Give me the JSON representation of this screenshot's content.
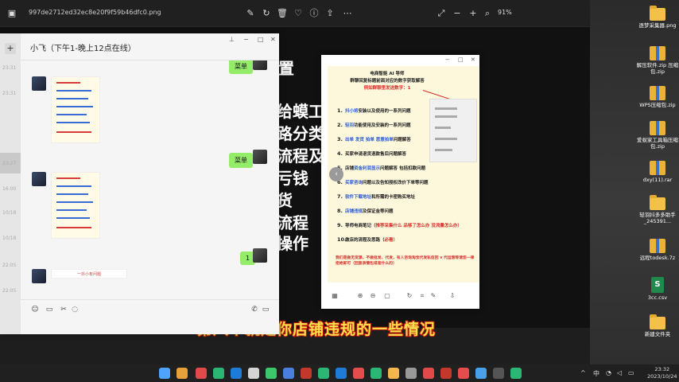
{
  "viewer": {
    "filename": "997de2712ed32ec8e20f9f59b46dfc0.png",
    "zoom": "91%",
    "big_text": [
      "置",
      "给蟆工",
      "路分类",
      "流程及话",
      "亏钱",
      "货",
      "流程",
      "操作"
    ],
    "subtitle": "第八个就是你店铺违规的一些情况"
  },
  "chat": {
    "title": "小飞（下午1-晚上12点在线）",
    "side_times": [
      "23:31",
      "23:31",
      "23:27",
      "16:00",
      "10/18",
      "10/18",
      "22:05",
      "22:05"
    ],
    "messages": {
      "m1": "菜单",
      "m2": "菜单",
      "m3": "1",
      "link": "一抖小有问题"
    }
  },
  "popup": {
    "h1": "电商智能 AI 导师",
    "h2": "群聊回复标题前面对应的数字获取解答",
    "h3": "例如群聊里发送数字：1",
    "items": [
      {
        "n": "1.",
        "a": "抖小将",
        "b": "安装以及使用的一系列问题"
      },
      {
        "n": "2.",
        "a": "轻羽",
        "b": "功能使用及安装的一系列问题"
      },
      {
        "n": "3.",
        "a": "出单 发货 拍单 恶意拍单",
        "b": "问题解答"
      },
      {
        "n": "4.",
        "a": "",
        "b": "买家申请退货退款售后问题解答",
        "mid": "退货退款售后"
      },
      {
        "n": "5.",
        "a": "店铺",
        "b": "问题解答 包括扣款问题",
        "mid": "资金利润显示"
      },
      {
        "n": "6.",
        "a": "买家咨询",
        "b": "问题以及告知授权改价下单等问题"
      },
      {
        "n": "7.",
        "a": "软件下载地址",
        "b": "和所需的卡密购买地址"
      },
      {
        "n": "8.",
        "a": "店铺违规",
        "b": "及保证金等问题"
      },
      {
        "n": "9.",
        "a": "导师电商笔记（",
        "b": "推荐采集什么 品够了怎么办 没流量怎么办）"
      },
      {
        "n": "10.",
        "a": "做店的流程及思路（",
        "b": "必看）"
      }
    ],
    "note": "我们是做无货源，不做批发、代发，有人咨询淘宝代发私信回 v 代运营等请您一律拒绝即可（回复表情包或者什么的）"
  },
  "desktop_icons": [
    {
      "label": "逐梦采集器.png",
      "kind": "folder"
    },
    {
      "label": "解压软件.zip 压缩包.zip",
      "kind": "zip"
    },
    {
      "label": "WPS压缩包.zip",
      "kind": "zip"
    },
    {
      "label": "爱蚁家工具箱压缩包.zip",
      "kind": "zip"
    },
    {
      "label": "dxy(11).rar",
      "kind": "zip"
    },
    {
      "label": "轻羽抖多多助手_245391...",
      "kind": "folder"
    },
    {
      "label": "远程todesk.7z",
      "kind": "zip"
    },
    {
      "label": "3cc.csv",
      "kind": "csv"
    },
    {
      "label": "新建文件夹",
      "kind": "folder"
    }
  ],
  "taskbar": {
    "time": "23:32",
    "date": "2023/10/24",
    "lang": "中",
    "colors": [
      "#4ea3ff",
      "#e8a13a",
      "#e04a4a",
      "#2bb673",
      "#1e7bd6",
      "#d4d4d4",
      "#3cc76b",
      "#4a7fe0",
      "#c0392b",
      "#2bb673",
      "#e54d4d",
      "#2bb673",
      "#f2b84b",
      "#999999",
      "#4aa0e8"
    ]
  }
}
